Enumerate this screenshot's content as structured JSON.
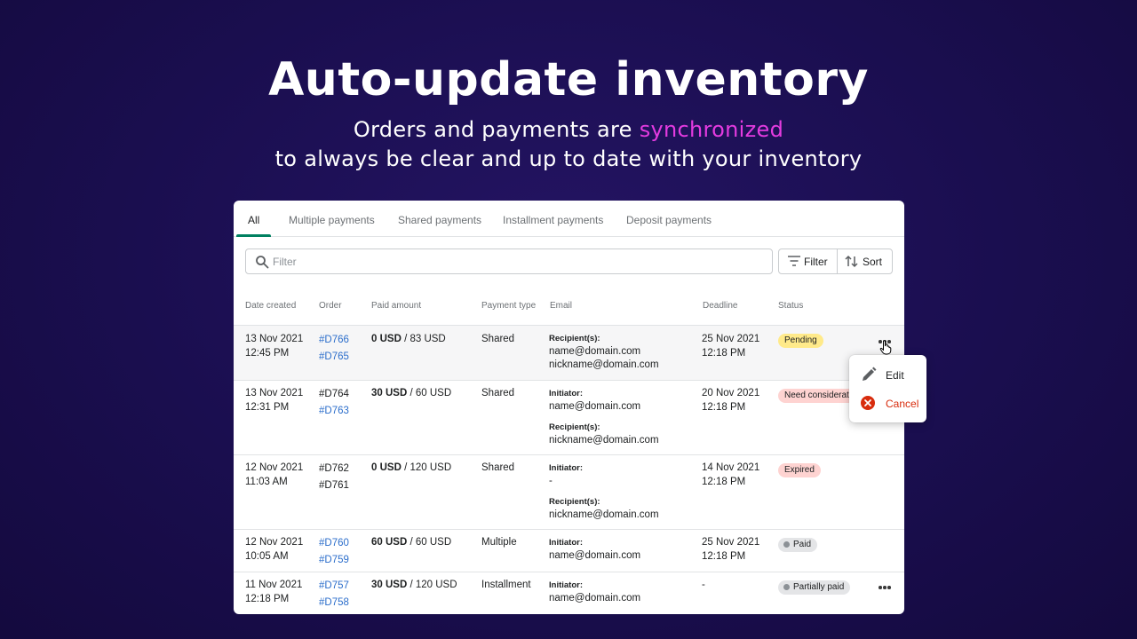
{
  "hero": {
    "title": "Auto-update inventory",
    "subtitle_pre": "Orders and payments are ",
    "subtitle_highlight": "synchronized",
    "subtitle_line2": "to always be clear and up to date with your inventory",
    "highlight_color": "#e43be0"
  },
  "tabs": [
    {
      "label": "All",
      "active": true
    },
    {
      "label": "Multiple payments"
    },
    {
      "label": "Shared payments"
    },
    {
      "label": "Installment payments"
    },
    {
      "label": "Deposit payments"
    }
  ],
  "filter": {
    "placeholder": "Filter",
    "filter_label": "Filter",
    "sort_label": "Sort"
  },
  "columns": [
    "Date created",
    "Order",
    "Paid amount",
    "Payment type",
    "Email",
    "Deadline",
    "Status"
  ],
  "rows": [
    {
      "date": "13 Nov 2021",
      "time": "12:45 PM",
      "order1": "#D766",
      "order2": "#D765",
      "paid": "0 USD",
      "total": " / 83 USD",
      "type": "Shared",
      "recipient_label": "Recipient(s):",
      "recipient1": "name@domain.com",
      "recipient2": "nickname@domain.com",
      "deadline_date": "25 Nov 2021",
      "deadline_time": "12:18 PM",
      "status": "Pending"
    },
    {
      "date": "13 Nov 2021",
      "time": "12:31 PM",
      "order1": "#D764",
      "order2": "#D763",
      "paid": "30 USD",
      "total": " / 60 USD",
      "type": "Shared",
      "initiator_label": "Initiator:",
      "initiator": "name@domain.com",
      "recipient_label": "Recipient(s):",
      "recipient": "nickname@domain.com",
      "deadline_date": "20 Nov 2021",
      "deadline_time": "12:18 PM",
      "status": "Need considerat"
    },
    {
      "date": "12 Nov 2021",
      "time": "11:03 AM",
      "order1": "#D762",
      "order2": "#D761",
      "paid": "0 USD",
      "total": " / 120 USD",
      "type": "Shared",
      "initiator_label": "Initiator:",
      "initiator": "-",
      "recipient_label": "Recipient(s):",
      "recipient": "nickname@domain.com",
      "deadline_date": "14 Nov 2021",
      "deadline_time": "12:18 PM",
      "status": "Expired"
    },
    {
      "date": "12 Nov 2021",
      "time": "10:05 AM",
      "order1": "#D760",
      "order2": "#D759",
      "paid": "60 USD",
      "total": " / 60 USD",
      "type": "Multiple",
      "initiator_label": "Initiator:",
      "initiator": "name@domain.com",
      "deadline_date": "25 Nov 2021",
      "deadline_time": "12:18 PM",
      "status": "Paid"
    },
    {
      "date": "11 Nov 2021",
      "time": "12:18 PM",
      "order1": "#D757",
      "order2": "#D758",
      "paid": "30 USD",
      "total": " / 120 USD",
      "type": "Installment",
      "initiator_label": "Initiator:",
      "initiator": "name@domain.com",
      "deadline_date": "-",
      "status": "Partially paid"
    }
  ],
  "menu": {
    "edit": "Edit",
    "cancel": "Cancel",
    "cancel_color": "#d82c0d"
  },
  "icons": [
    "search-icon",
    "filter-lines-icon",
    "sort-arrows-icon",
    "pencil-icon",
    "cancel-circle-icon",
    "more-horizontal-icon",
    "hand-pointer-icon"
  ]
}
